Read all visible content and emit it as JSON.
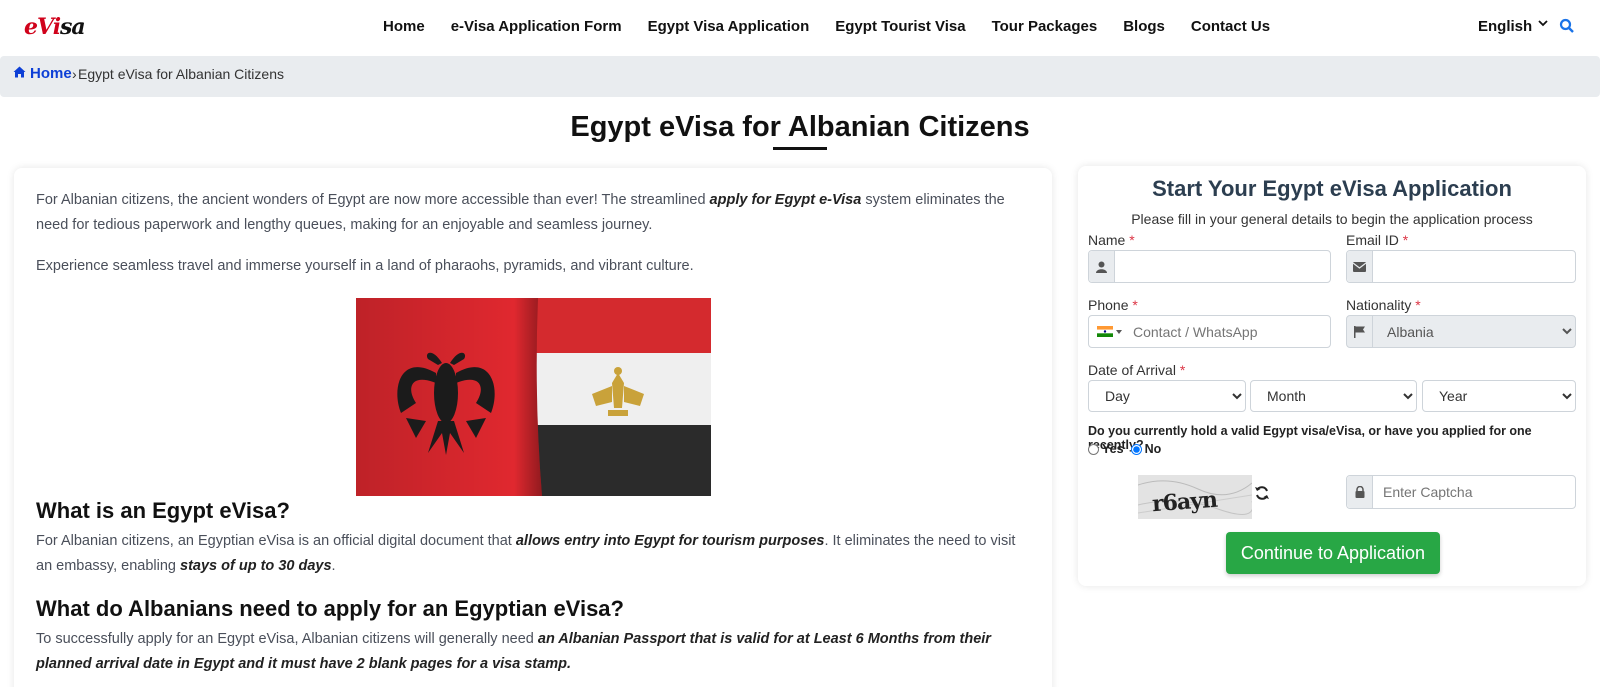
{
  "logo": {
    "part1": "eV",
    "part2": "i",
    "part3": "sa"
  },
  "nav": [
    {
      "label": "Home"
    },
    {
      "label": "e-Visa Application Form"
    },
    {
      "label": "Egypt Visa Application"
    },
    {
      "label": "Egypt Tourist Visa"
    },
    {
      "label": "Tour Packages"
    },
    {
      "label": "Blogs"
    },
    {
      "label": "Contact Us"
    }
  ],
  "language": {
    "selected": "English"
  },
  "icons": {
    "search": "search-icon",
    "home": "home-icon",
    "chevron": "chevron-down-icon"
  },
  "breadcrumb": {
    "home": "Home",
    "separator": "›",
    "current": "Egypt eVisa for Albanian Citizens"
  },
  "page": {
    "title": "Egypt eVisa for Albanian Citizens"
  },
  "content": {
    "intro_1": "For Albanian citizens, the ancient wonders of Egypt are now more accessible than ever! The streamlined ",
    "intro_bold": "apply for Egypt e-Visa",
    "intro_2": " system eliminates the need for tedious paperwork and lengthy queues, making for an enjoyable and seamless journey.",
    "intro_p2": "Experience seamless travel and immerse yourself in a land of pharaohs, pyramids, and vibrant culture.",
    "h_what": "What is an Egypt eVisa?",
    "what_1": "For Albanian citizens, an Egyptian eVisa is an official digital document that ",
    "what_bold1": "allows entry into Egypt for tourism purposes",
    "what_2": ". It eliminates the need to visit an embassy, enabling ",
    "what_bold2": "stays of up to 30 days",
    "what_3": ".",
    "h_need": "What do Albanians need to apply for an Egyptian eVisa?",
    "need_1": "To successfully apply for an Egypt eVisa, Albanian citizens will generally need ",
    "need_bold": "an Albanian Passport that is valid for at Least 6 Months from their planned arrival date in Egypt and it must have 2 blank pages for a visa stamp."
  },
  "form": {
    "title": "Start Your Egypt eVisa Application",
    "subtitle": "Please fill in your general details to begin the application process",
    "name_label": "Name",
    "email_label": "Email ID",
    "phone_label": "Phone",
    "phone_placeholder": "Contact / WhatsApp",
    "nationality_label": "Nationality",
    "nationality_value": "Albania",
    "arrival_label": "Date of Arrival",
    "day": "Day",
    "month": "Month",
    "year": "Year",
    "required_mark": "*",
    "question": "Do you currently hold a valid Egypt visa/eVisa, or have you applied for one recently?",
    "yes": "Yes",
    "no": "No",
    "selected_answer": "No",
    "captcha_text": "r6ayn",
    "captcha_placeholder": "Enter Captcha",
    "submit": "Continue to Application"
  },
  "colors": {
    "accent_blue": "#0d3fd6",
    "submit_green": "#28a745",
    "required_red": "#dc3545",
    "form_title": "#2c3e50"
  }
}
